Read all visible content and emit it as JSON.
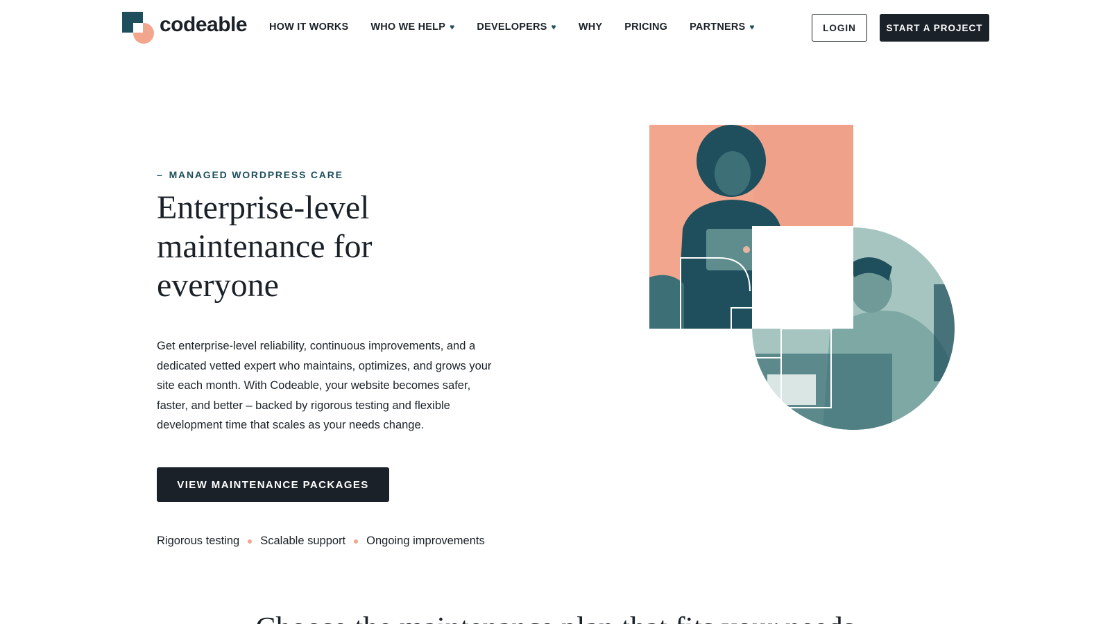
{
  "header": {
    "logo_text": "codeable",
    "nav": [
      {
        "label": "HOW IT WORKS",
        "dropdown": false
      },
      {
        "label": "WHO WE HELP",
        "dropdown": true
      },
      {
        "label": "DEVELOPERS",
        "dropdown": true
      },
      {
        "label": "WHY",
        "dropdown": false
      },
      {
        "label": "PRICING",
        "dropdown": false
      },
      {
        "label": "PARTNERS",
        "dropdown": true
      }
    ],
    "login_label": "LOGIN",
    "start_label": "START A PROJECT"
  },
  "hero": {
    "eyebrow_dash": "–",
    "eyebrow": "MANAGED WORDPRESS CARE",
    "headline": "Enterprise-level maintenance for everyone",
    "body": "Get enterprise-level reliability, continuous improvements, and a dedicated vetted expert who maintains, optimizes, and grows your site each month. With Codeable, your website becomes safer, faster, and better – backed by rigorous testing and flexible development time that scales as your needs change.",
    "cta_label": "VIEW MAINTENANCE PACKAGES",
    "features": [
      "Rigorous testing",
      "Scalable support",
      "Ongoing improvements"
    ]
  },
  "next_section": {
    "title": "Choose the maintenance plan that fits your needs"
  },
  "colors": {
    "dark": "#1b2128",
    "teal": "#1f4e5c",
    "salmon": "#f2a68e",
    "sage": "#a6c5c0"
  }
}
